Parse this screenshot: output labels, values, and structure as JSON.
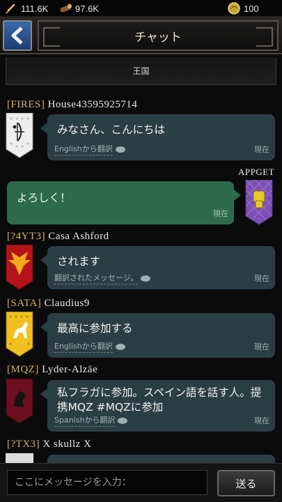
{
  "resources": {
    "grain": "111.6K",
    "wood": "97.6K",
    "gold": "100"
  },
  "header": {
    "title": "チャット"
  },
  "tab": {
    "label": "王国"
  },
  "input": {
    "placeholder": "ここにメッセージを入力："
  },
  "send_label": "送る",
  "messages": [
    {
      "tag": "[FIRES]",
      "name": "House43595925714",
      "text": "みなさん、こんにちは",
      "translation": "Englishから翻訳",
      "time": "現在"
    },
    {
      "tag": "",
      "name": "APPGET",
      "text": "よろしく！",
      "translation": "",
      "time": "現在"
    },
    {
      "tag": "[?4YT3]",
      "name": "Casa Ashford",
      "text": "されます",
      "translation": "翻訳されたメッセージ。",
      "time": "現在"
    },
    {
      "tag": "[SATA]",
      "name": "Claudius9",
      "text": "最高に参加する",
      "translation": "Englishから翻訳",
      "time": "現在"
    },
    {
      "tag": "[MQZ]",
      "name": "Lyder-Alzāe",
      "text": "私フラガに参加。スペイン語を話す人。提携MQZ #MQZに参加",
      "translation": "Spanishから翻訳",
      "time": "現在"
    },
    {
      "tag": "[?TX3]",
      "name": "X skullz X",
      "text": "",
      "translation": "",
      "time": ""
    }
  ],
  "colors": {
    "gold_tag": "#d4b36a",
    "bubble_other": "#2c3e45",
    "bubble_mine": "#2e6a4e",
    "back_button": "#2a5290"
  }
}
